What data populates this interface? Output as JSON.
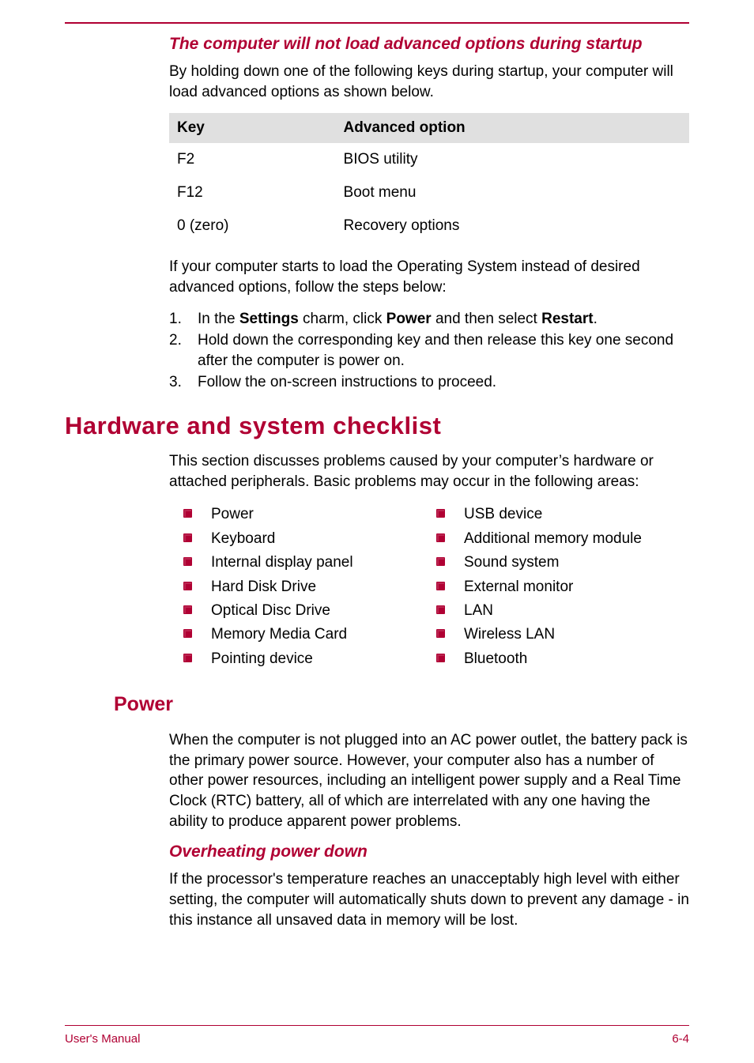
{
  "sec1": {
    "heading": "The computer will not load advanced options during startup",
    "intro": "By holding down one of the following keys during startup, your computer will load advanced options as shown below.",
    "table": {
      "headers": [
        "Key",
        "Advanced option"
      ],
      "rows": [
        [
          "F2",
          "BIOS utility"
        ],
        [
          "F12",
          "Boot menu"
        ],
        [
          "0 (zero)",
          "Recovery options"
        ]
      ]
    },
    "after_table": "If your computer starts to load the Operating System instead of desired advanced options, follow the steps below:",
    "steps": {
      "s1a": "In the ",
      "s1b": "Settings",
      "s1c": " charm, click ",
      "s1d": "Power",
      "s1e": " and then select ",
      "s1f": "Restart",
      "s1g": ".",
      "s2": "Hold down the corresponding key and then release this key one second after the computer is power on.",
      "s3": "Follow the on-screen instructions to proceed."
    }
  },
  "sec2": {
    "heading": "Hardware and system checklist",
    "intro": "This section discusses problems caused by your computer’s hardware or attached peripherals. Basic problems may occur in the following areas:",
    "left": [
      "Power",
      "Keyboard",
      "Internal display panel",
      "Hard Disk Drive",
      "Optical Disc Drive",
      "Memory Media Card",
      "Pointing device"
    ],
    "right": [
      "USB device",
      "Additional memory module",
      "Sound system",
      "External monitor",
      "LAN",
      "Wireless LAN",
      "Bluetooth"
    ]
  },
  "sec3": {
    "heading": "Power",
    "para": "When the computer is not plugged into an AC power outlet, the battery pack is the primary power source. However, your computer also has a number of other power resources, including an intelligent power supply and a Real Time Clock (RTC) battery, all of which are interrelated with any one having the ability to produce apparent power problems."
  },
  "sec4": {
    "heading": "Overheating power down",
    "para": "If the processor's temperature reaches an unacceptably high level with either setting, the computer will automatically shuts down to prevent any damage - in this instance all unsaved data in memory will be lost."
  },
  "footer": {
    "left": "User's Manual",
    "right": "6-4"
  },
  "nums": {
    "n1": "1.",
    "n2": "2.",
    "n3": "3."
  }
}
